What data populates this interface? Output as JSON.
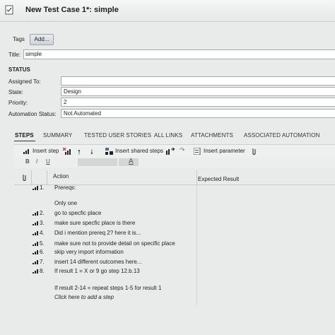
{
  "window": {
    "title": "New Test Case 1*: simple"
  },
  "tags": {
    "label": "Tags",
    "add_button": "Add..."
  },
  "title_field": {
    "label": "Title:",
    "value": "simple"
  },
  "status": {
    "heading": "STATUS",
    "fields": [
      {
        "label": "Assigned To:",
        "value": ""
      },
      {
        "label": "State:",
        "value": "Design"
      },
      {
        "label": "Priority:",
        "value": "2"
      },
      {
        "label": "Automation Status:",
        "value": "Not Automated"
      }
    ]
  },
  "tabs": [
    "STEPS",
    "SUMMARY",
    "TESTED USER STORIES",
    "ALL LINKS",
    "ATTACHMENTS",
    "ASSOCIATED AUTOMATION"
  ],
  "toolbar": {
    "insert_step": "Insert step",
    "insert_shared_steps": "Insert shared steps",
    "insert_parameter": "Insert parameter"
  },
  "format": {
    "bold": "B",
    "italic": "I",
    "underline": "U",
    "font_color": "A"
  },
  "grid": {
    "action_header": "Action",
    "expected_header": "Expected Result"
  },
  "steps": [
    {
      "num": "1.",
      "text": "Prereqs:"
    },
    {
      "num": "",
      "text": ""
    },
    {
      "num": "",
      "text": "Only one"
    },
    {
      "num": "2.",
      "text": "go to specfic place"
    },
    {
      "num": "3.",
      "text": "make sure specfic place is there"
    },
    {
      "num": "4.",
      "text": "Did i mention prereq 2? here it is..."
    },
    {
      "num": "5.",
      "text": "make sure not to provide detail on specific place"
    },
    {
      "num": "6.",
      "text": "skip very import information"
    },
    {
      "num": "7.",
      "text": "insert 14 different outcomes here..."
    },
    {
      "num": "8.",
      "text": "If result 1 = X or 9 go step 12.b.13"
    },
    {
      "num": "",
      "text": ""
    },
    {
      "num": "",
      "text": "If result 2-14 = repeat steps 1-5 for result 1"
    },
    {
      "num": "",
      "text": "Click here to add a step"
    }
  ]
}
